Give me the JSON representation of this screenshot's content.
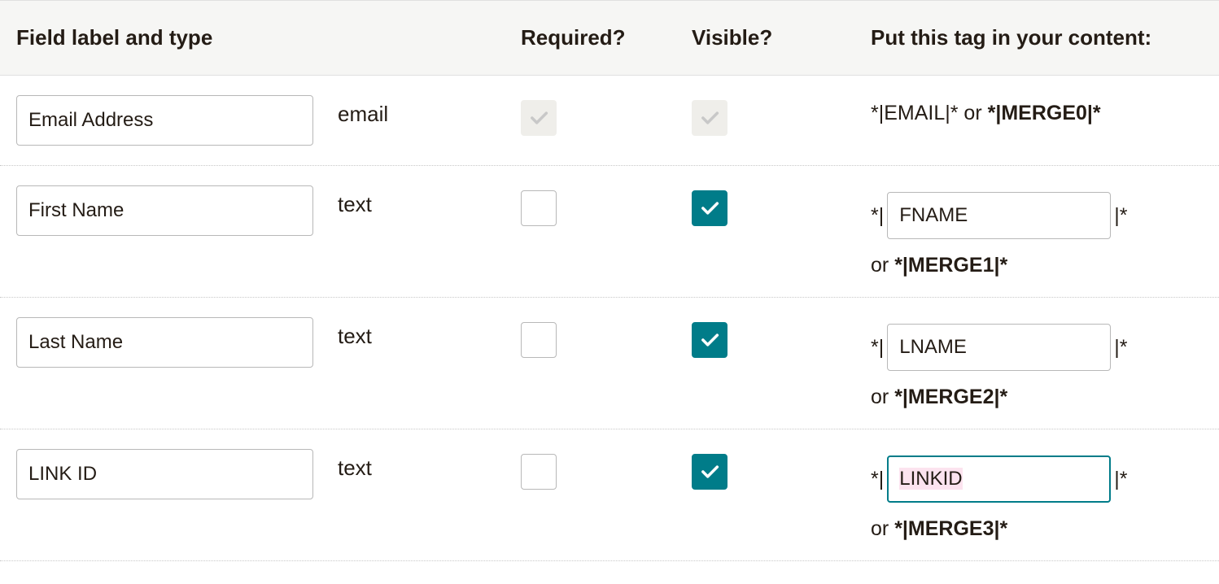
{
  "headers": {
    "field_label_type": "Field label and type",
    "required": "Required?",
    "visible": "Visible?",
    "tag": "Put this tag in your content:"
  },
  "rows": [
    {
      "label": "Email Address",
      "type": "email",
      "required_disabled": true,
      "visible_disabled": true,
      "required": true,
      "visible": true,
      "tag_simple": true,
      "tag1": "*|EMAIL|*",
      "or": " or ",
      "tag2": "*|MERGE0|*"
    },
    {
      "label": "First Name",
      "type": "text",
      "required_disabled": false,
      "visible_disabled": false,
      "required": false,
      "visible": true,
      "tag_simple": false,
      "tag_prefix": "*|",
      "tag_value": "FNAME",
      "tag_suffix": "|*",
      "tag_focused": false,
      "tag_highlight": false,
      "or_text": "or ",
      "merge_tag": "*|MERGE1|*"
    },
    {
      "label": "Last Name",
      "type": "text",
      "required_disabled": false,
      "visible_disabled": false,
      "required": false,
      "visible": true,
      "tag_simple": false,
      "tag_prefix": "*|",
      "tag_value": "LNAME",
      "tag_suffix": "|*",
      "tag_focused": false,
      "tag_highlight": false,
      "or_text": "or ",
      "merge_tag": "*|MERGE2|*"
    },
    {
      "label": "LINK ID",
      "type": "text",
      "required_disabled": false,
      "visible_disabled": false,
      "required": false,
      "visible": true,
      "tag_simple": false,
      "tag_prefix": "*|",
      "tag_value": "LINKID",
      "tag_suffix": "|*",
      "tag_focused": true,
      "tag_highlight": true,
      "or_text": "or ",
      "merge_tag": "*|MERGE3|*"
    }
  ]
}
